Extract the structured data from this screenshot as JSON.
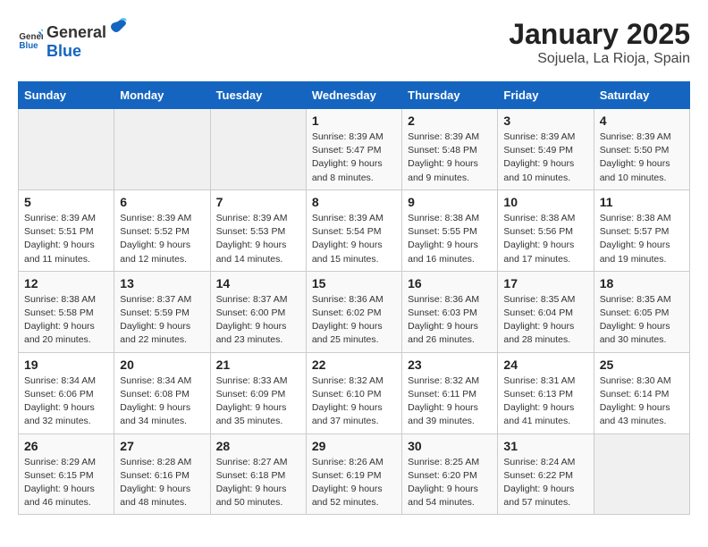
{
  "header": {
    "logo_general": "General",
    "logo_blue": "Blue",
    "title": "January 2025",
    "subtitle": "Sojuela, La Rioja, Spain"
  },
  "weekdays": [
    "Sunday",
    "Monday",
    "Tuesday",
    "Wednesday",
    "Thursday",
    "Friday",
    "Saturday"
  ],
  "weeks": [
    [
      {
        "day": "",
        "info": ""
      },
      {
        "day": "",
        "info": ""
      },
      {
        "day": "",
        "info": ""
      },
      {
        "day": "1",
        "info": "Sunrise: 8:39 AM\nSunset: 5:47 PM\nDaylight: 9 hours\nand 8 minutes."
      },
      {
        "day": "2",
        "info": "Sunrise: 8:39 AM\nSunset: 5:48 PM\nDaylight: 9 hours\nand 9 minutes."
      },
      {
        "day": "3",
        "info": "Sunrise: 8:39 AM\nSunset: 5:49 PM\nDaylight: 9 hours\nand 10 minutes."
      },
      {
        "day": "4",
        "info": "Sunrise: 8:39 AM\nSunset: 5:50 PM\nDaylight: 9 hours\nand 10 minutes."
      }
    ],
    [
      {
        "day": "5",
        "info": "Sunrise: 8:39 AM\nSunset: 5:51 PM\nDaylight: 9 hours\nand 11 minutes."
      },
      {
        "day": "6",
        "info": "Sunrise: 8:39 AM\nSunset: 5:52 PM\nDaylight: 9 hours\nand 12 minutes."
      },
      {
        "day": "7",
        "info": "Sunrise: 8:39 AM\nSunset: 5:53 PM\nDaylight: 9 hours\nand 14 minutes."
      },
      {
        "day": "8",
        "info": "Sunrise: 8:39 AM\nSunset: 5:54 PM\nDaylight: 9 hours\nand 15 minutes."
      },
      {
        "day": "9",
        "info": "Sunrise: 8:38 AM\nSunset: 5:55 PM\nDaylight: 9 hours\nand 16 minutes."
      },
      {
        "day": "10",
        "info": "Sunrise: 8:38 AM\nSunset: 5:56 PM\nDaylight: 9 hours\nand 17 minutes."
      },
      {
        "day": "11",
        "info": "Sunrise: 8:38 AM\nSunset: 5:57 PM\nDaylight: 9 hours\nand 19 minutes."
      }
    ],
    [
      {
        "day": "12",
        "info": "Sunrise: 8:38 AM\nSunset: 5:58 PM\nDaylight: 9 hours\nand 20 minutes."
      },
      {
        "day": "13",
        "info": "Sunrise: 8:37 AM\nSunset: 5:59 PM\nDaylight: 9 hours\nand 22 minutes."
      },
      {
        "day": "14",
        "info": "Sunrise: 8:37 AM\nSunset: 6:00 PM\nDaylight: 9 hours\nand 23 minutes."
      },
      {
        "day": "15",
        "info": "Sunrise: 8:36 AM\nSunset: 6:02 PM\nDaylight: 9 hours\nand 25 minutes."
      },
      {
        "day": "16",
        "info": "Sunrise: 8:36 AM\nSunset: 6:03 PM\nDaylight: 9 hours\nand 26 minutes."
      },
      {
        "day": "17",
        "info": "Sunrise: 8:35 AM\nSunset: 6:04 PM\nDaylight: 9 hours\nand 28 minutes."
      },
      {
        "day": "18",
        "info": "Sunrise: 8:35 AM\nSunset: 6:05 PM\nDaylight: 9 hours\nand 30 minutes."
      }
    ],
    [
      {
        "day": "19",
        "info": "Sunrise: 8:34 AM\nSunset: 6:06 PM\nDaylight: 9 hours\nand 32 minutes."
      },
      {
        "day": "20",
        "info": "Sunrise: 8:34 AM\nSunset: 6:08 PM\nDaylight: 9 hours\nand 34 minutes."
      },
      {
        "day": "21",
        "info": "Sunrise: 8:33 AM\nSunset: 6:09 PM\nDaylight: 9 hours\nand 35 minutes."
      },
      {
        "day": "22",
        "info": "Sunrise: 8:32 AM\nSunset: 6:10 PM\nDaylight: 9 hours\nand 37 minutes."
      },
      {
        "day": "23",
        "info": "Sunrise: 8:32 AM\nSunset: 6:11 PM\nDaylight: 9 hours\nand 39 minutes."
      },
      {
        "day": "24",
        "info": "Sunrise: 8:31 AM\nSunset: 6:13 PM\nDaylight: 9 hours\nand 41 minutes."
      },
      {
        "day": "25",
        "info": "Sunrise: 8:30 AM\nSunset: 6:14 PM\nDaylight: 9 hours\nand 43 minutes."
      }
    ],
    [
      {
        "day": "26",
        "info": "Sunrise: 8:29 AM\nSunset: 6:15 PM\nDaylight: 9 hours\nand 46 minutes."
      },
      {
        "day": "27",
        "info": "Sunrise: 8:28 AM\nSunset: 6:16 PM\nDaylight: 9 hours\nand 48 minutes."
      },
      {
        "day": "28",
        "info": "Sunrise: 8:27 AM\nSunset: 6:18 PM\nDaylight: 9 hours\nand 50 minutes."
      },
      {
        "day": "29",
        "info": "Sunrise: 8:26 AM\nSunset: 6:19 PM\nDaylight: 9 hours\nand 52 minutes."
      },
      {
        "day": "30",
        "info": "Sunrise: 8:25 AM\nSunset: 6:20 PM\nDaylight: 9 hours\nand 54 minutes."
      },
      {
        "day": "31",
        "info": "Sunrise: 8:24 AM\nSunset: 6:22 PM\nDaylight: 9 hours\nand 57 minutes."
      },
      {
        "day": "",
        "info": ""
      }
    ]
  ]
}
